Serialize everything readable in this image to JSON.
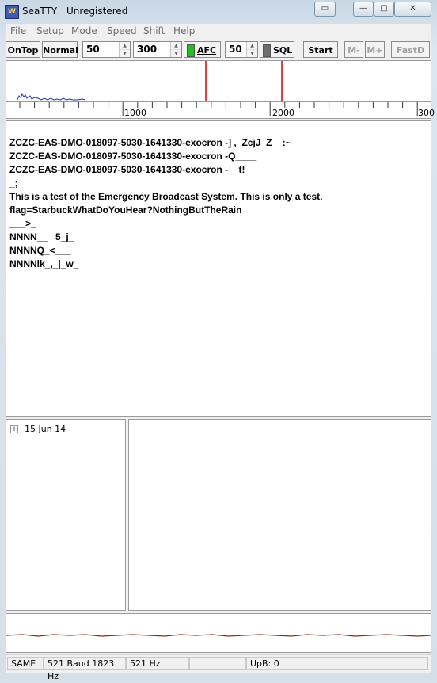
{
  "window": {
    "title": "SeaTTY",
    "status": "Unregistered",
    "icon_name": "seatty-app-icon"
  },
  "menu": [
    "File",
    "Setup",
    "Mode",
    "Speed",
    "Shift",
    "Help"
  ],
  "toolbar": {
    "ontop": "OnTop",
    "normal": "Normal",
    "speed_value": "50",
    "shift_value": "300",
    "afc_label": "AFC",
    "afc_led_color": "#1fc01f",
    "squelch_value": "50",
    "sql_label": "SQL",
    "sql_led_color": "#6d6d6d",
    "start": "Start",
    "m_minus": "M-",
    "m_plus": "M+",
    "fastd": "FastD"
  },
  "ruler": {
    "labels": [
      "1000",
      "2000",
      "300"
    ]
  },
  "text_lines": [
    "ZCZC-EAS-DMO-018097-5030-1641330-exocron -] ,_ZcjJ_Z__:~",
    "ZCZC-EAS-DMO-018097-5030-1641330-exocron -Q____",
    "ZCZC-EAS-DMO-018097-5030-1641330-exocron -__t!_",
    "_;",
    "This is a test of the Emergency Broadcast System. This is only a test.",
    "flag=StarbuckWhatDoYouHear?NothingButTheRain",
    "___>_",
    "NNNN__   5_j_",
    "NNNNQ_<___",
    "NNNNlk_,_|_w_"
  ],
  "tree": {
    "expander": "+",
    "date_label": "15 Jun 14"
  },
  "status": {
    "mode": "SAME",
    "baud_freq": "521 Baud 1823 Hz",
    "offset": "521 Hz",
    "upb": "UpB: 0"
  },
  "colors": {
    "marker_line": "#cc0000",
    "spectrum_trace": "#2233aa",
    "scope_trace": "#8b2a1a"
  }
}
